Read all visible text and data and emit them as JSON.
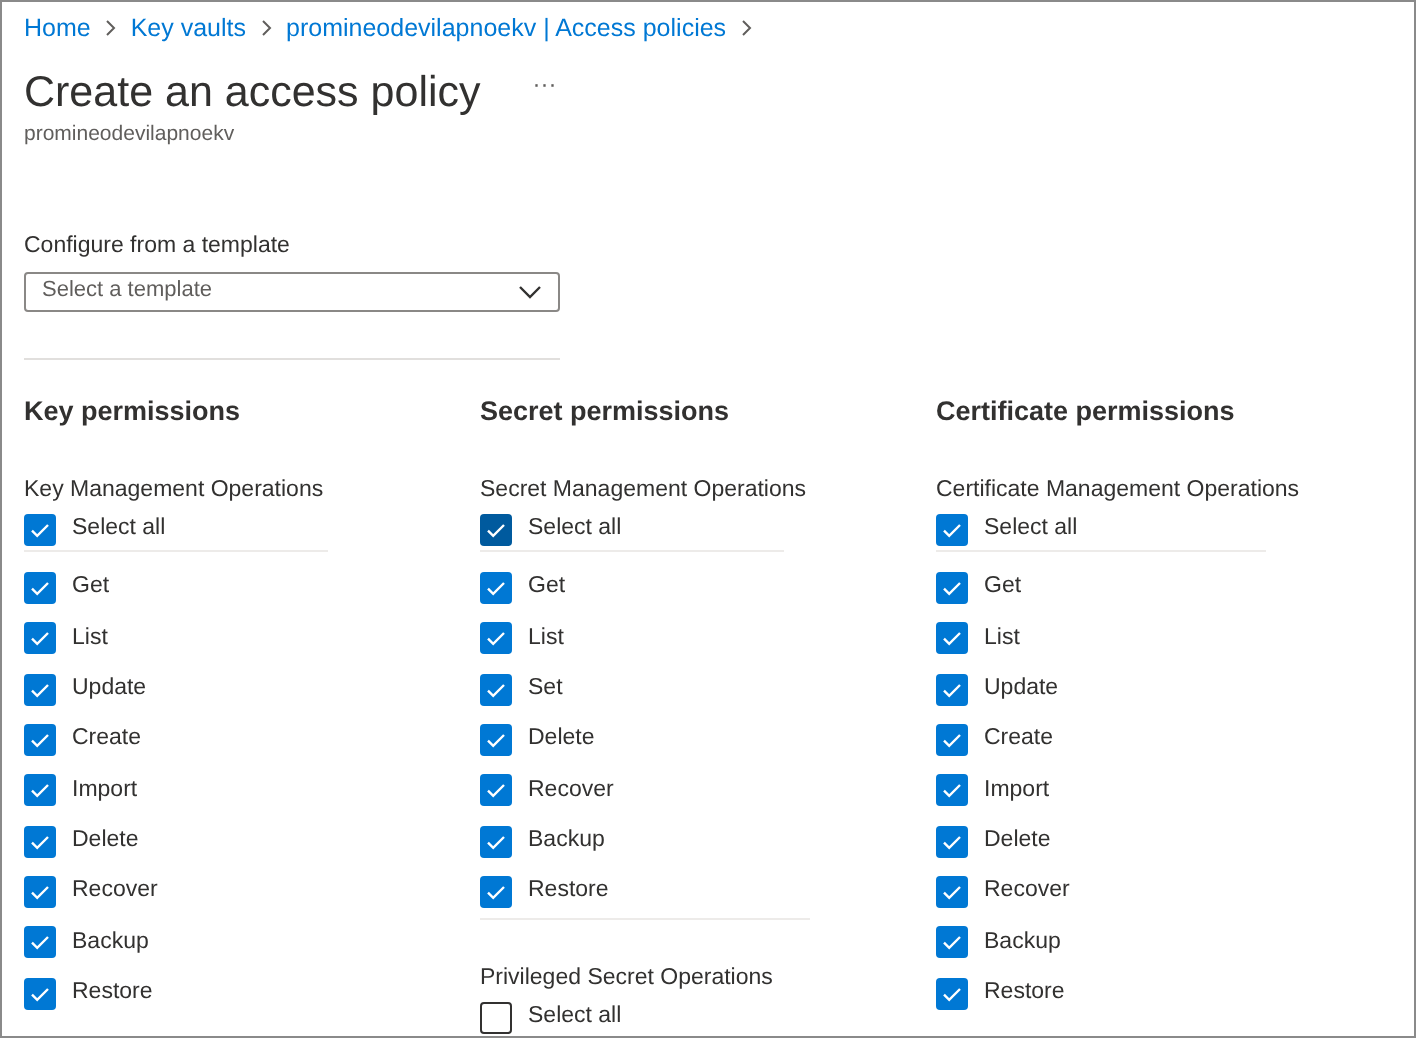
{
  "breadcrumb": [
    {
      "label": "Home"
    },
    {
      "label": "Key vaults"
    },
    {
      "label": "promineodevilapnoekv | Access policies"
    }
  ],
  "page": {
    "title": "Create an access policy",
    "more": "···",
    "subtitle": "promineodevilapnoekv"
  },
  "template": {
    "label": "Configure from a template",
    "placeholder": "Select a template"
  },
  "columns": [
    {
      "title": "Key permissions",
      "groups": [
        {
          "label": "Key Management Operations",
          "items": [
            {
              "kind": "select_all",
              "label": "Select all",
              "checked": true,
              "focused": false
            },
            {
              "kind": "permission",
              "label": "Get",
              "checked": true,
              "focused": false
            },
            {
              "kind": "permission",
              "label": "List",
              "checked": true,
              "focused": false
            },
            {
              "kind": "permission",
              "label": "Update",
              "checked": true,
              "focused": false
            },
            {
              "kind": "permission",
              "label": "Create",
              "checked": true,
              "focused": false
            },
            {
              "kind": "permission",
              "label": "Import",
              "checked": true,
              "focused": false
            },
            {
              "kind": "permission",
              "label": "Delete",
              "checked": true,
              "focused": false
            },
            {
              "kind": "permission",
              "label": "Recover",
              "checked": true,
              "focused": false
            },
            {
              "kind": "permission",
              "label": "Backup",
              "checked": true,
              "focused": false
            },
            {
              "kind": "permission",
              "label": "Restore",
              "checked": true,
              "focused": false
            }
          ]
        }
      ]
    },
    {
      "title": "Secret permissions",
      "groups": [
        {
          "label": "Secret Management Operations",
          "items": [
            {
              "kind": "select_all",
              "label": "Select all",
              "checked": true,
              "focused": true
            },
            {
              "kind": "permission",
              "label": "Get",
              "checked": true,
              "focused": false
            },
            {
              "kind": "permission",
              "label": "List",
              "checked": true,
              "focused": false
            },
            {
              "kind": "permission",
              "label": "Set",
              "checked": true,
              "focused": false
            },
            {
              "kind": "permission",
              "label": "Delete",
              "checked": true,
              "focused": false
            },
            {
              "kind": "permission",
              "label": "Recover",
              "checked": true,
              "focused": false
            },
            {
              "kind": "permission",
              "label": "Backup",
              "checked": true,
              "focused": false
            },
            {
              "kind": "permission",
              "label": "Restore",
              "checked": true,
              "focused": false
            }
          ]
        },
        {
          "label": "Privileged Secret Operations",
          "items": [
            {
              "kind": "select_all",
              "label": "Select all",
              "checked": false,
              "focused": false
            }
          ]
        }
      ]
    },
    {
      "title": "Certificate permissions",
      "groups": [
        {
          "label": "Certificate Management Operations",
          "items": [
            {
              "kind": "select_all",
              "label": "Select all",
              "checked": true,
              "focused": false
            },
            {
              "kind": "permission",
              "label": "Get",
              "checked": true,
              "focused": false
            },
            {
              "kind": "permission",
              "label": "List",
              "checked": true,
              "focused": false
            },
            {
              "kind": "permission",
              "label": "Update",
              "checked": true,
              "focused": false
            },
            {
              "kind": "permission",
              "label": "Create",
              "checked": true,
              "focused": false
            },
            {
              "kind": "permission",
              "label": "Import",
              "checked": true,
              "focused": false
            },
            {
              "kind": "permission",
              "label": "Delete",
              "checked": true,
              "focused": false
            },
            {
              "kind": "permission",
              "label": "Recover",
              "checked": true,
              "focused": false
            },
            {
              "kind": "permission",
              "label": "Backup",
              "checked": true,
              "focused": false
            },
            {
              "kind": "permission",
              "label": "Restore",
              "checked": true,
              "focused": false
            }
          ]
        }
      ]
    }
  ]
}
